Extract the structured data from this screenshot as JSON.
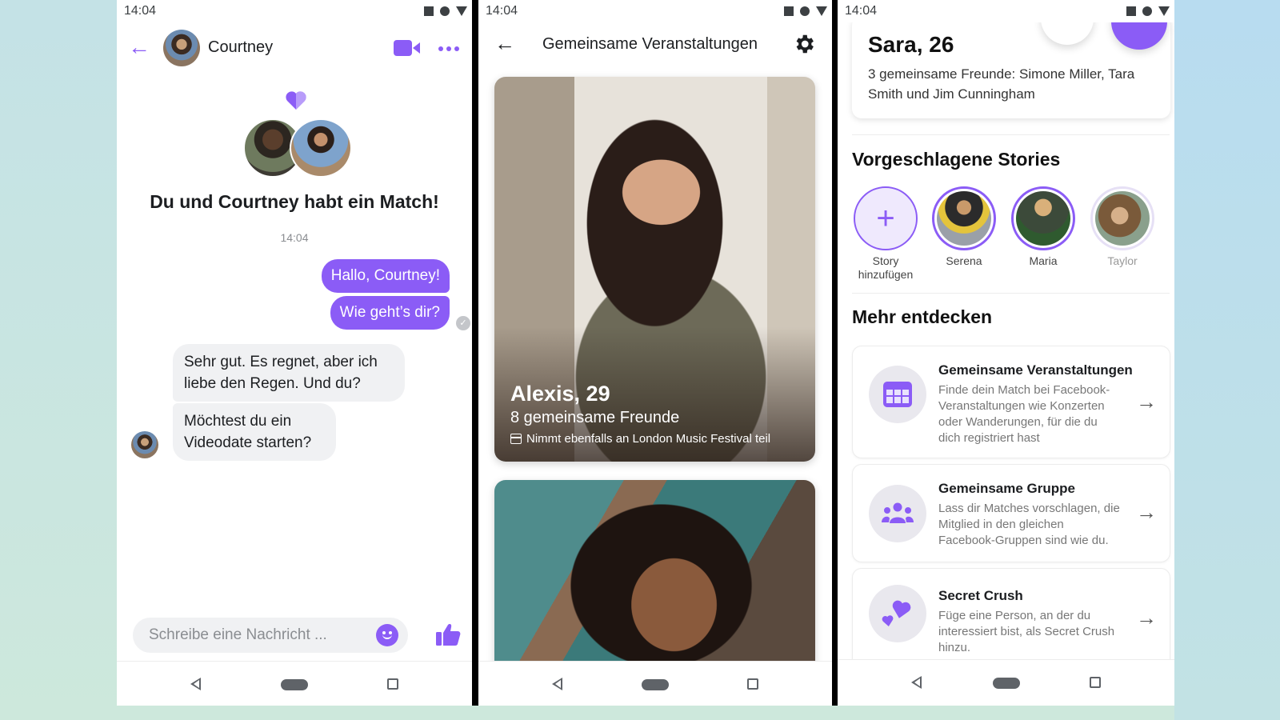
{
  "colors": {
    "accent": "#8b5cf6",
    "text": "#1c1e21",
    "muted": "#8a8d91"
  },
  "status_bar": {
    "time": "14:04"
  },
  "chat": {
    "contact_name": "Courtney",
    "match_title": "Du und Courtney habt ein Match!",
    "match_time": "14:04",
    "messages_out": [
      "Hallo, Courtney!",
      "Wie geht’s dir?"
    ],
    "messages_in": [
      "Sehr gut. Es regnet, aber ich liebe den Regen. Und du?",
      "Möchtest du ein Videodate starten?"
    ],
    "composer_placeholder": "Schreibe eine Nachricht ...",
    "composer_value": ""
  },
  "events": {
    "title": "Gemeinsame Veranstaltungen",
    "cards": [
      {
        "name": "Alexis, 29",
        "friends": "8 gemeinsame Freunde",
        "event": "Nimmt ebenfalls an London Music Festival teil"
      }
    ]
  },
  "profile": {
    "name": "Sara, 26",
    "friends": "3 gemeinsame Freunde: Simone Miller, Tara Smith und Jim Cunningham",
    "stories_title": "Vorgeschlagene Stories",
    "stories": [
      {
        "label": "Story hinzufügen"
      },
      {
        "label": "Serena"
      },
      {
        "label": "Maria"
      },
      {
        "label": "Taylor"
      }
    ],
    "discover_title": "Mehr entdecken",
    "features": [
      {
        "icon": "calendar-icon",
        "title": "Gemeinsame Veranstaltungen",
        "desc": "Finde dein Match bei Facebook-Veranstaltungen wie Konzerten oder Wanderungen, für die du dich registriert hast"
      },
      {
        "icon": "group-icon",
        "title": "Gemeinsame Gruppe",
        "desc": "Lass dir Matches vorschlagen, die Mitglied in den gleichen Facebook-Gruppen sind wie du."
      },
      {
        "icon": "hearts-icon",
        "title": "Secret Crush",
        "desc": "Füge eine Person, an der du interessiert bist, als Secret Crush hinzu."
      }
    ]
  }
}
